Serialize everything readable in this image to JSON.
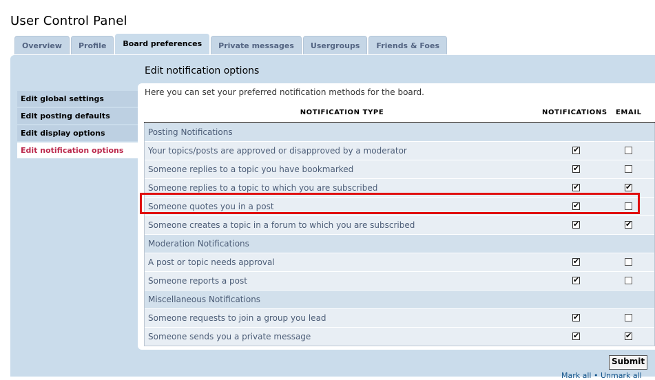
{
  "page_title": "User Control Panel",
  "tabs": [
    {
      "label": "Overview",
      "active": false
    },
    {
      "label": "Profile",
      "active": false
    },
    {
      "label": "Board preferences",
      "active": true
    },
    {
      "label": "Private messages",
      "active": false
    },
    {
      "label": "Usergroups",
      "active": false
    },
    {
      "label": "Friends & Foes",
      "active": false
    }
  ],
  "section_title": "Edit notification options",
  "menu": [
    {
      "label": "Edit global settings"
    },
    {
      "label": "Edit posting defaults"
    },
    {
      "label": "Edit display options"
    },
    {
      "label": "Edit notification options"
    }
  ],
  "intro": "Here you can set your preferred notification methods for the board.",
  "headers": {
    "type": "NOTIFICATION TYPE",
    "notifications": "NOTIFICATIONS",
    "email": "EMAIL"
  },
  "groups": [
    {
      "label": "Posting Notifications"
    },
    {
      "label": "Moderation Notifications"
    },
    {
      "label": "Miscellaneous Notifications"
    }
  ],
  "items": [
    {
      "label": "Your topics/posts are approved or disapproved by a moderator",
      "notify": true,
      "email": false
    },
    {
      "label": "Someone replies to a topic you have bookmarked",
      "notify": true,
      "email": false
    },
    {
      "label": "Someone replies to a topic to which you are subscribed",
      "notify": true,
      "email": true
    },
    {
      "label": "Someone quotes you in a post",
      "notify": true,
      "email": false
    },
    {
      "label": "Someone creates a topic in a forum to which you are subscribed",
      "notify": true,
      "email": true
    },
    {
      "label": "A post or topic needs approval",
      "notify": true,
      "email": false
    },
    {
      "label": "Someone reports a post",
      "notify": true,
      "email": false
    },
    {
      "label": "Someone requests to join a group you lead",
      "notify": true,
      "email": false
    },
    {
      "label": "Someone sends you a private message",
      "notify": true,
      "email": true
    }
  ],
  "submit_label": "Submit",
  "bottom_links": "Mark all • Unmark all",
  "colors": {
    "panel": "#cadceb",
    "active_menu": "#bc2a4d",
    "highlight": "#e01010"
  }
}
